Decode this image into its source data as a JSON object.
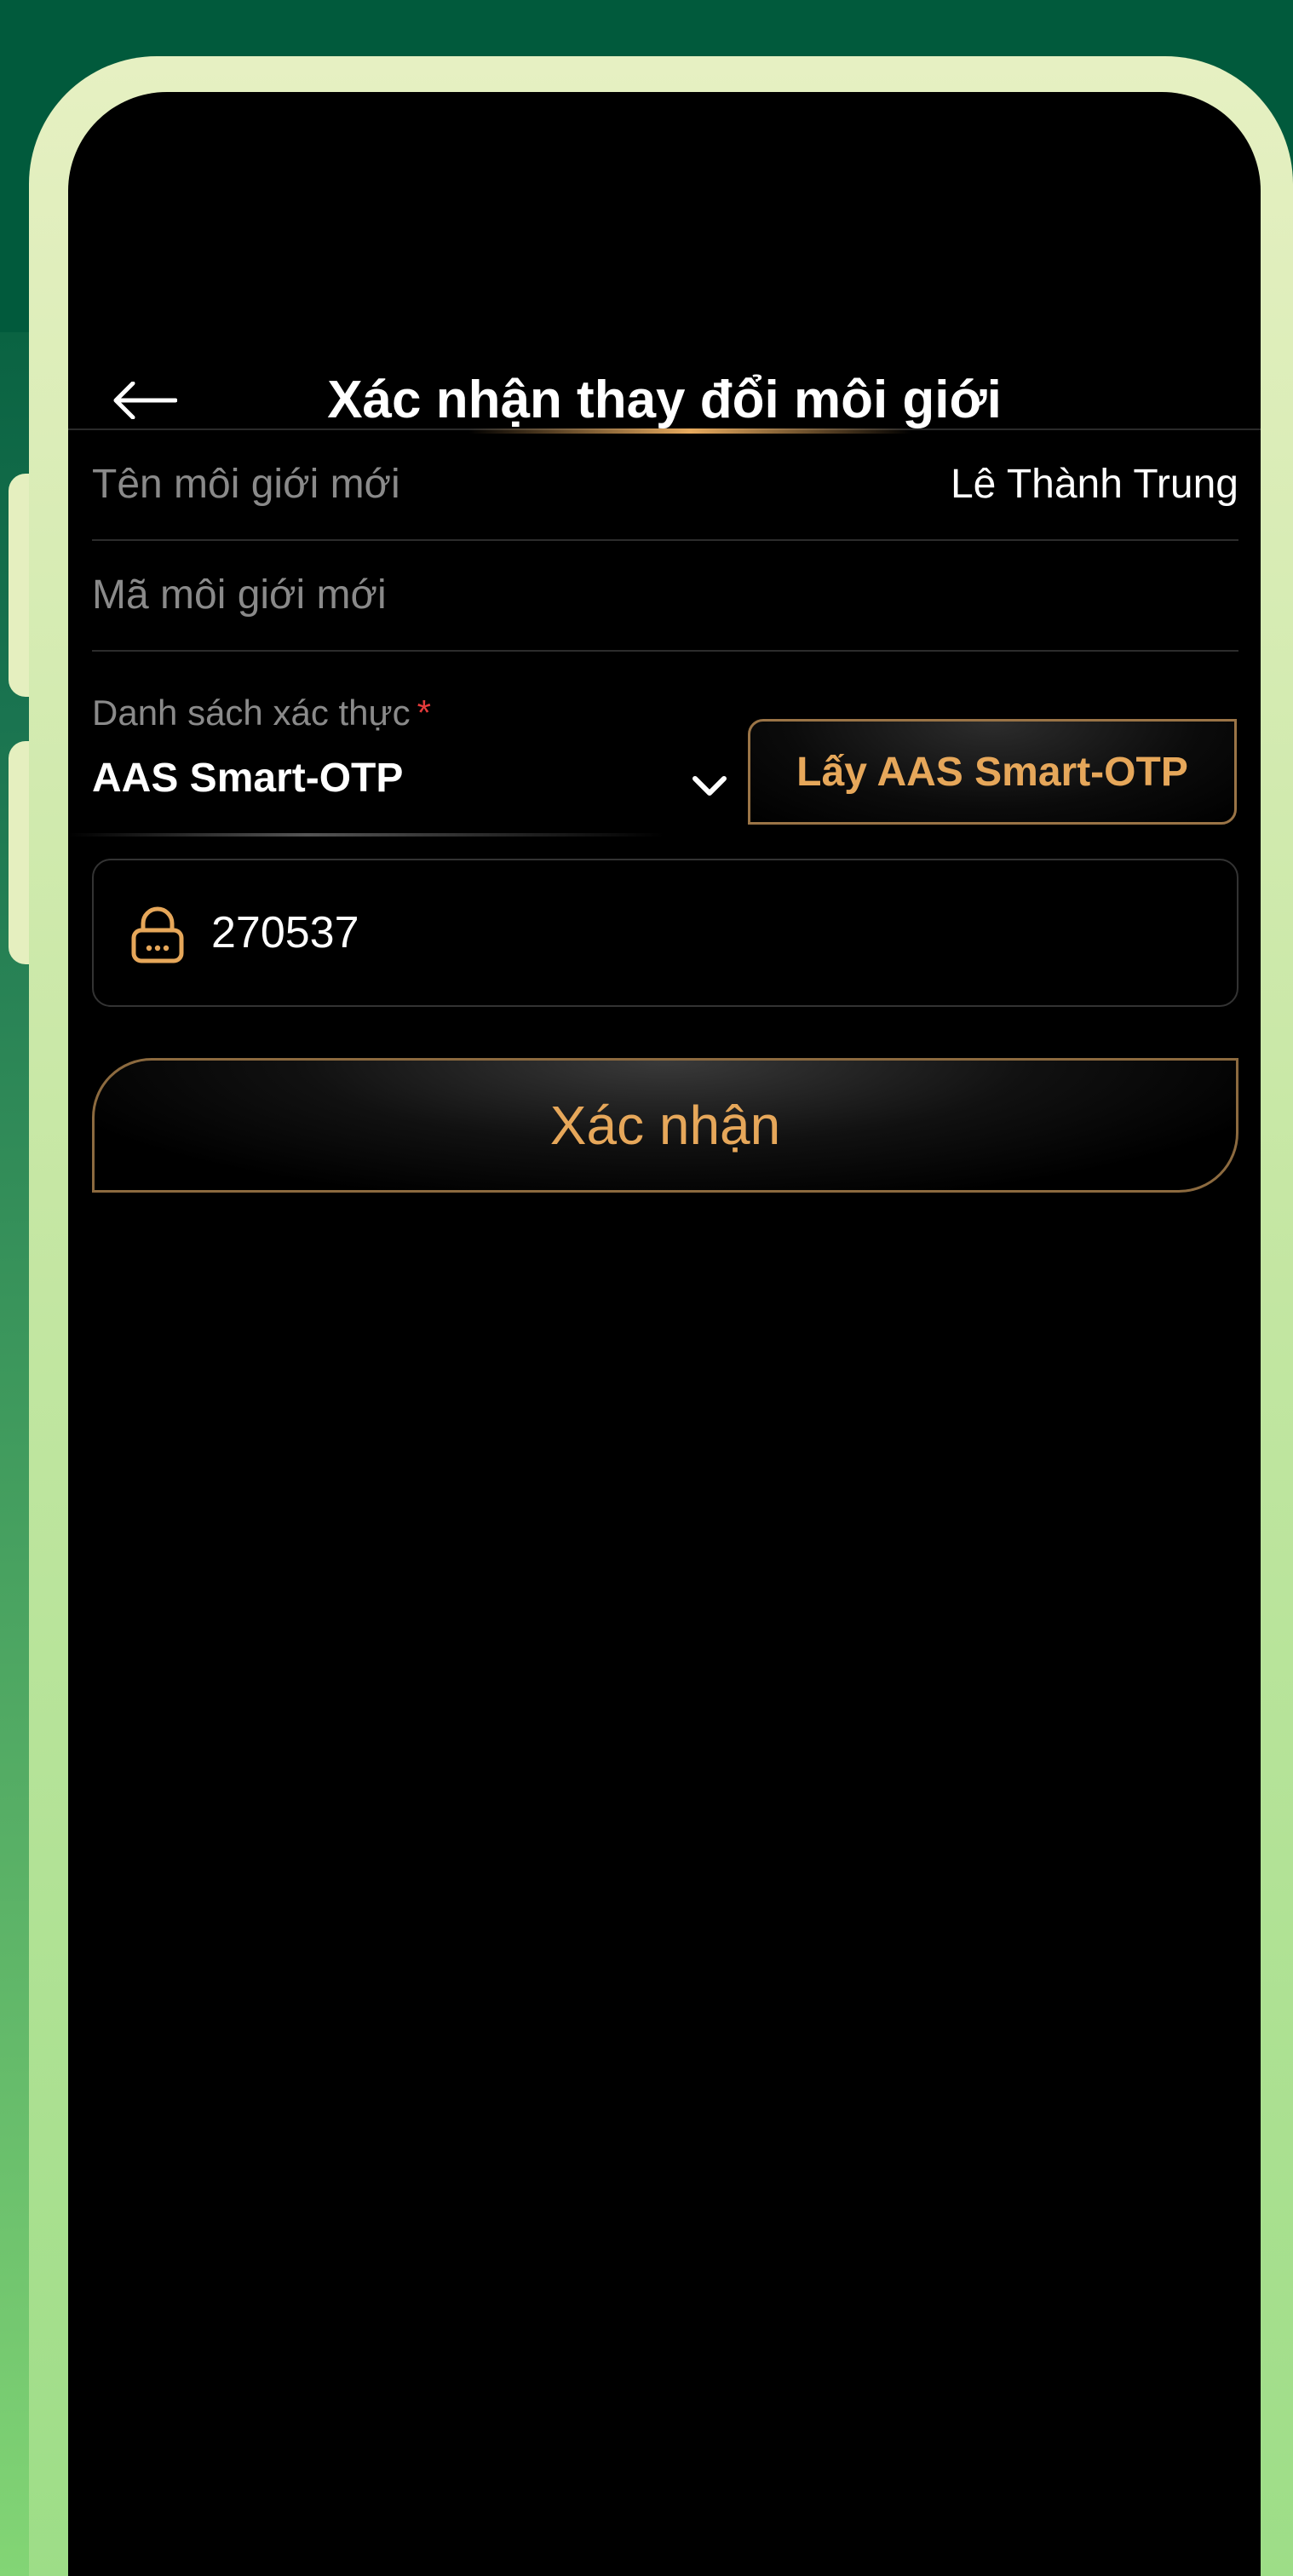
{
  "header": {
    "title": "Xác nhận thay đổi môi giới"
  },
  "fields": {
    "broker_name_label": "Tên môi giới mới",
    "broker_name_value": "Lê Thành Trung",
    "broker_code_label": "Mã môi giới mới"
  },
  "auth": {
    "label": "Danh sách xác thực",
    "required_mark": "*",
    "selected": "AAS Smart-OTP",
    "get_otp_button": "Lấy AAS Smart-OTP"
  },
  "otp": {
    "value": "270537"
  },
  "confirm_button": "Xác nhận",
  "colors": {
    "accent_gold": "#e6a75a",
    "required_red": "#e53b3b",
    "background": "#000000",
    "frame": "#e6f0c2"
  },
  "icons": {
    "back": "arrow-left-icon",
    "dropdown": "chevron-down-icon",
    "otp": "lock-icon"
  }
}
